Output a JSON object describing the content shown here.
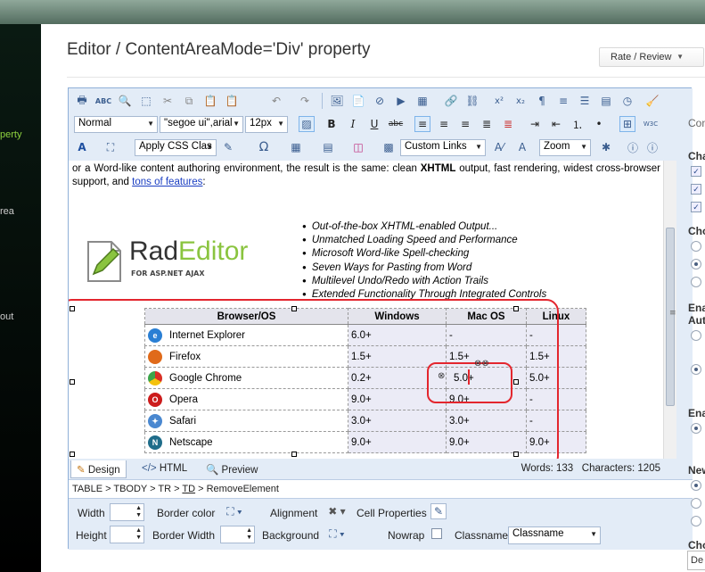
{
  "nav": {
    "items": [
      "perty",
      "rea",
      "out"
    ]
  },
  "page": {
    "title": "Editor / ContentAreaMode='Div' property",
    "rate_label": "Rate / Review"
  },
  "toolbar": {
    "format_block": "Normal",
    "font_name": "\"segoe ui\",arial",
    "font_size": "12px",
    "apply_css": "Apply CSS Clas",
    "links": "Custom Links",
    "zoom": "Zoom"
  },
  "content": {
    "intro_text": "or a Word-like content authoring environment, the result is the same: clean ",
    "intro_bold": "XHTML",
    "intro_text2": " output, fast rendering, widest cross-browser support, and ",
    "intro_link": "tons of features",
    "intro_end": ":",
    "logo_word_a": "Rad",
    "logo_word_b": "Editor",
    "logo_sub": "FOR ASP.NET AJAX",
    "features": [
      "Out-of-the-box XHTML-enabled Output...",
      "Unmatched Loading Speed and Performance",
      "Microsoft Word-like Spell-checking",
      "Seven Ways for Pasting from Word",
      "Multilevel Undo/Redo with Action Trails",
      "Extended Functionality Through Integrated Controls"
    ],
    "table": {
      "headers": [
        "Browser/OS",
        "Windows",
        "Mac OS",
        "Linux"
      ],
      "rows": [
        {
          "name": "Internet Explorer",
          "win": "6.0+",
          "mac": "-",
          "linux": "-",
          "color": "#2a7fd4"
        },
        {
          "name": "Firefox",
          "win": "1.5+",
          "mac": "1.5+",
          "linux": "1.5+",
          "color": "#e06a1a"
        },
        {
          "name": "Google Chrome",
          "win": "0.2+",
          "mac": "5.0+",
          "linux": "5.0+",
          "color": "#3ba54a"
        },
        {
          "name": "Opera",
          "win": "9.0+",
          "mac": "9.0+",
          "linux": "-",
          "color": "#cc1c1c"
        },
        {
          "name": "Safari",
          "win": "3.0+",
          "mac": "3.0+",
          "linux": "-",
          "color": "#4a88d0"
        },
        {
          "name": "Netscape",
          "win": "9.0+",
          "mac": "9.0+",
          "linux": "9.0+",
          "color": "#1f6d8a"
        }
      ]
    }
  },
  "modes": {
    "design": "Design",
    "html": "HTML",
    "preview": "Preview",
    "words": "Words: 133",
    "chars": "Characters: 1205"
  },
  "path": {
    "prefix": "TABLE > TBODY > TR > ",
    "current": "TD",
    "suffix": " > RemoveElement"
  },
  "props": {
    "width": "Width",
    "height": "Height",
    "border_color": "Border color",
    "border_width": "Border Width",
    "alignment": "Alignment",
    "background": "Background",
    "cell_properties": "Cell Properties",
    "nowrap": "Nowrap",
    "classname_label": "Classname",
    "classname_value": "Classname"
  },
  "side": {
    "headers": [
      "Con",
      "Cha",
      "Cho",
      "Ena",
      "Aut",
      "Ena",
      "New",
      "Cho"
    ],
    "input": "De"
  }
}
